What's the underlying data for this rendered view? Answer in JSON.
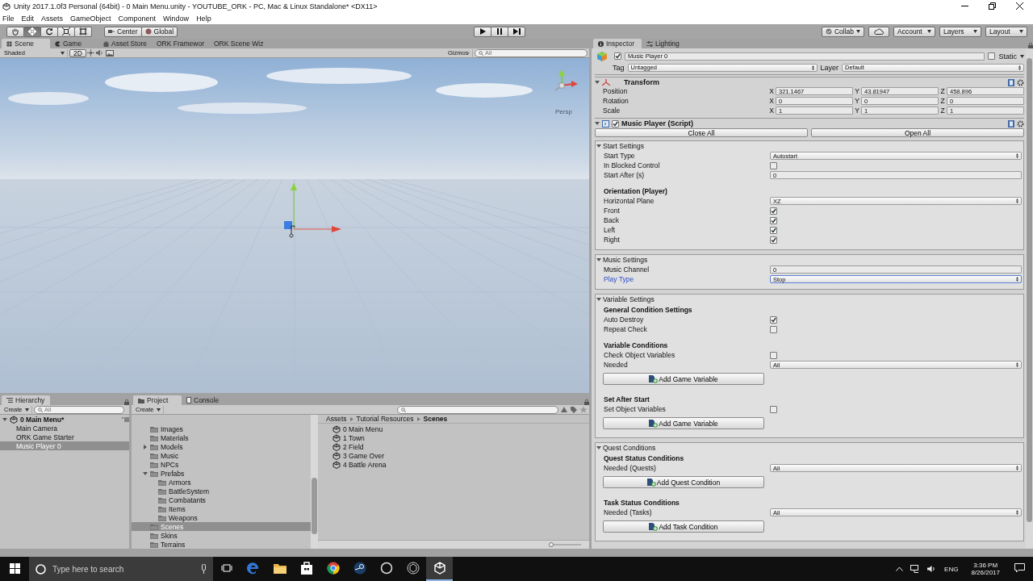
{
  "window": {
    "title": "Unity 2017.1.0f3 Personal (64bit) - 0 Main Menu.unity - YOUTUBE_ORK - PC, Mac & Linux Standalone* <DX11>"
  },
  "menu": [
    "File",
    "Edit",
    "Assets",
    "GameObject",
    "Component",
    "Window",
    "Help"
  ],
  "tools": [
    {
      "kind": "hand",
      "selected": false
    },
    {
      "kind": "move",
      "selected": true
    },
    {
      "kind": "rotate",
      "selected": false
    },
    {
      "kind": "scale",
      "selected": false
    },
    {
      "kind": "rect",
      "selected": false
    }
  ],
  "pivot_buttons": [
    {
      "kind": "pivot",
      "label": "Center"
    },
    {
      "kind": "space",
      "label": "Global"
    }
  ],
  "top_right_buttons": [
    {
      "kind": "collab",
      "label": "Collab"
    },
    {
      "kind": "cloud"
    },
    {
      "kind": "menu",
      "label": "Account"
    },
    {
      "kind": "menu",
      "label": "Layers"
    },
    {
      "kind": "menu",
      "label": "Layout"
    }
  ],
  "scene_tabs": [
    {
      "kind": "scene",
      "label": "Scene",
      "selected": true
    },
    {
      "kind": "game",
      "label": "Game",
      "selected": false
    },
    {
      "kind": "store",
      "label": "Asset Store",
      "selected": false
    },
    {
      "kind": "plain",
      "label": "ORK Framewor",
      "selected": false
    },
    {
      "kind": "plain",
      "label": "ORK Scene Wiz",
      "selected": false
    }
  ],
  "scene_toolbar": {
    "shading": "Shaded",
    "mode": "2D",
    "gizmos": "Gizmos",
    "search_placeholder": "All"
  },
  "scene_view": {
    "camera_label": "Persp"
  },
  "hierarchy": {
    "tab": "Hierarchy",
    "create": "Create",
    "search_placeholder": "All",
    "scene": "0 Main Menu*",
    "expanded": true,
    "items": [
      {
        "label": "Main Camera",
        "selected": false
      },
      {
        "label": "ORK Game Starter",
        "selected": false
      },
      {
        "label": "Music Player 0",
        "selected": true
      }
    ]
  },
  "project": {
    "tabs": [
      {
        "kind": "project",
        "label": "Project",
        "selected": true
      },
      {
        "kind": "console",
        "label": "Console",
        "selected": false
      }
    ],
    "create": "Create",
    "folders": [
      {
        "label": "Images",
        "selected": false
      },
      {
        "label": "Materials",
        "selected": false
      },
      {
        "label": "Models",
        "selected": false,
        "expanded": false
      },
      {
        "label": "Music",
        "selected": false
      },
      {
        "label": "NPCs",
        "selected": false
      },
      {
        "label": "Prefabs",
        "selected": false,
        "expanded": true,
        "children": [
          {
            "label": "Armors",
            "selected": false
          },
          {
            "label": "BattleSystem",
            "selected": false
          },
          {
            "label": "Combatants",
            "selected": false
          },
          {
            "label": "Items",
            "selected": false
          },
          {
            "label": "Weapons",
            "selected": false
          }
        ]
      },
      {
        "label": "Scenes",
        "selected": true
      },
      {
        "label": "Skins",
        "selected": false
      },
      {
        "label": "Terrains",
        "selected": false
      }
    ],
    "breadcrumb": [
      "Assets",
      "Tutorial Resources",
      "Scenes"
    ],
    "files": [
      "0 Main Menu",
      "1 Town",
      "2 Field",
      "3 Game Over",
      "4 Battle Arena"
    ],
    "zoom": {
      "level": 0
    }
  },
  "inspector": {
    "tabs": [
      {
        "kind": "info",
        "label": "Inspector",
        "selected": true
      },
      {
        "kind": "lighting",
        "label": "Lighting",
        "selected": false
      }
    ],
    "object": {
      "active": true,
      "name": "Music Player 0",
      "static": false,
      "static_label": "Static",
      "tag_label": "Tag",
      "tag": "Untagged",
      "layer_label": "Layer",
      "layer": "Default"
    },
    "transform": {
      "title": "Transform",
      "expanded": true,
      "rows": [
        {
          "label": "Position",
          "values": [
            {
              "axis": "X",
              "value": "321.1467"
            },
            {
              "axis": "Y",
              "value": "43.81947"
            },
            {
              "axis": "Z",
              "value": "458.896"
            }
          ]
        },
        {
          "label": "Rotation",
          "values": [
            {
              "axis": "X",
              "value": "0"
            },
            {
              "axis": "Y",
              "value": "0"
            },
            {
              "axis": "Z",
              "value": "0"
            }
          ]
        },
        {
          "label": "Scale",
          "values": [
            {
              "axis": "X",
              "value": "1"
            },
            {
              "axis": "Y",
              "value": "1"
            },
            {
              "axis": "Z",
              "value": "1"
            }
          ]
        }
      ]
    },
    "script": {
      "title": "Music Player (Script)",
      "enabled": true,
      "expanded": true,
      "buttons": [
        "Close All",
        "Open All"
      ],
      "sections": [
        {
          "title": "Start Settings",
          "expanded": true,
          "rows": [
            {
              "kind": "dropdown",
              "label": "Start Type",
              "value": "Autostart",
              "focused": false
            },
            {
              "kind": "checkbox",
              "label": "In Blocked Control",
              "checked": false,
              "focused": false
            },
            {
              "kind": "number",
              "label": "Start After (s)",
              "value": "0",
              "focused": false
            },
            {
              "kind": "heading",
              "label": "Orientation (Player)"
            },
            {
              "kind": "dropdown",
              "label": "Horizontal Plane",
              "value": "XZ",
              "focused": false
            },
            {
              "kind": "checkbox",
              "label": "Front",
              "checked": true,
              "focused": false
            },
            {
              "kind": "checkbox",
              "label": "Back",
              "checked": true,
              "focused": false
            },
            {
              "kind": "checkbox",
              "label": "Left",
              "checked": true,
              "focused": false
            },
            {
              "kind": "checkbox",
              "label": "Right",
              "checked": true,
              "focused": false
            }
          ]
        },
        {
          "title": "Music Settings",
          "expanded": true,
          "rows": [
            {
              "kind": "number",
              "label": "Music Channel",
              "value": "0",
              "focused": false
            },
            {
              "kind": "dropdown",
              "label": "Play Type",
              "value": "Stop",
              "focused": true
            }
          ]
        },
        {
          "title": "Variable Settings",
          "expanded": true,
          "rows": [
            {
              "kind": "heading",
              "label": "General Condition Settings"
            },
            {
              "kind": "checkbox",
              "label": "Auto Destroy",
              "checked": true,
              "focused": false
            },
            {
              "kind": "checkbox",
              "label": "Repeat Check",
              "checked": false,
              "focused": false
            },
            {
              "kind": "heading",
              "label": "Variable Conditions"
            },
            {
              "kind": "checkbox",
              "label": "Check Object Variables",
              "checked": false,
              "focused": false
            },
            {
              "kind": "dropdown",
              "label": "Needed",
              "value": "All",
              "focused": false
            },
            {
              "kind": "button",
              "label": "Add Game Variable"
            },
            {
              "kind": "heading",
              "label": "Set After Start"
            },
            {
              "kind": "checkbox",
              "label": "Set Object Variables",
              "checked": false,
              "focused": false
            },
            {
              "kind": "button",
              "label": "Add Game Variable"
            }
          ]
        },
        {
          "title": "Quest Conditions",
          "expanded": true,
          "rows": [
            {
              "kind": "heading",
              "label": "Quest Status Conditions"
            },
            {
              "kind": "dropdown",
              "label": "Needed (Quests)",
              "value": "All",
              "focused": false
            },
            {
              "kind": "button",
              "label": "Add Quest Condition"
            },
            {
              "kind": "heading",
              "label": "Task Status Conditions"
            },
            {
              "kind": "dropdown",
              "label": "Needed (Tasks)",
              "value": "All",
              "focused": false
            },
            {
              "kind": "button",
              "label": "Add Task Condition"
            }
          ]
        }
      ]
    }
  },
  "taskbar": {
    "search_placeholder": "Type here to search",
    "apps": [
      {
        "kind": "taskview",
        "selected": false
      },
      {
        "kind": "edge",
        "selected": false
      },
      {
        "kind": "folder",
        "selected": false
      },
      {
        "kind": "store",
        "selected": false
      },
      {
        "kind": "chrome",
        "selected": false
      },
      {
        "kind": "steam",
        "selected": false
      },
      {
        "kind": "obs",
        "selected": false
      },
      {
        "kind": "unityhub",
        "selected": false
      },
      {
        "kind": "unity",
        "selected": true
      }
    ],
    "language": "ENG",
    "time": "3:36 PM",
    "date": "8/26/2017"
  }
}
